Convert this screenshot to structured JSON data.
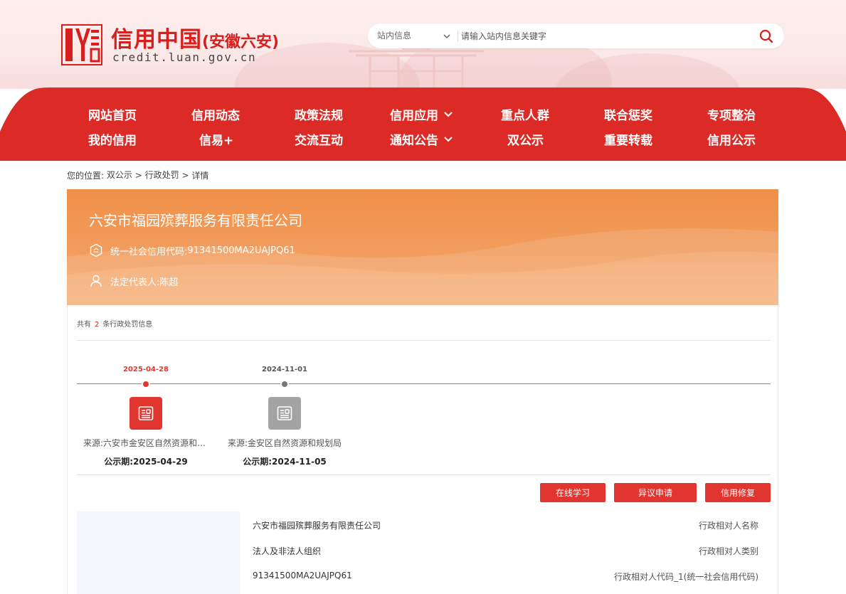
{
  "header": {
    "site_title": "信用中国",
    "site_subtitle": "(安徽六安)",
    "site_url": "credit.luan.gov.cn",
    "colors": {
      "brand": "#d7201d",
      "nav": "#dc2a26"
    }
  },
  "search": {
    "scope_label": "站内信息",
    "placeholder": "请输入站内信息关键字",
    "button_icon": "search-icon"
  },
  "nav": {
    "row1": [
      "网站首页",
      "信用动态",
      "政策法规",
      "信用应用",
      "重点人群",
      "联合惩奖",
      "专项整治"
    ],
    "row2": [
      "我的信用",
      "信易+",
      "交流互动",
      "通知公告",
      "双公示",
      "重要转载",
      "信用公示"
    ]
  },
  "breadcrumb": {
    "prefix": "您的位置:",
    "items": [
      "双公示",
      "行政处罚",
      "详情"
    ],
    "separator": ">"
  },
  "banner": {
    "company_name": "六安市福园殡葬服务有限责任公司",
    "credit_code_label": "统一社会信用代码:",
    "credit_code": "91341500MA2UAJPQ61",
    "legal_rep_label": "法定代表人:",
    "legal_rep": "陈超"
  },
  "summary": {
    "prefix": "共有",
    "count": "2",
    "suffix": "条行政处罚信息"
  },
  "timeline": [
    {
      "date": "2025-04-28",
      "source": "来源:六安市金安区自然资源和规划局",
      "period_label": "公示期:",
      "period": "2025-04-29",
      "active": true
    },
    {
      "date": "2024-11-01",
      "source": "来源:金安区自然资源和规划局",
      "period_label": "公示期:",
      "period": "2024-11-05",
      "active": false
    }
  ],
  "actions": {
    "study": "在线学习",
    "objection": "异议申请",
    "repair": "信用修复"
  },
  "detail": [
    {
      "label": "行政相对人名称",
      "value": "六安市福园殡葬服务有限责任公司"
    },
    {
      "label": "行政相对人类别",
      "value": "法人及非法人组织"
    },
    {
      "label": "行政相对人代码_1(统一社会信用代码)",
      "value": "91341500MA2UAJPQ61"
    }
  ]
}
